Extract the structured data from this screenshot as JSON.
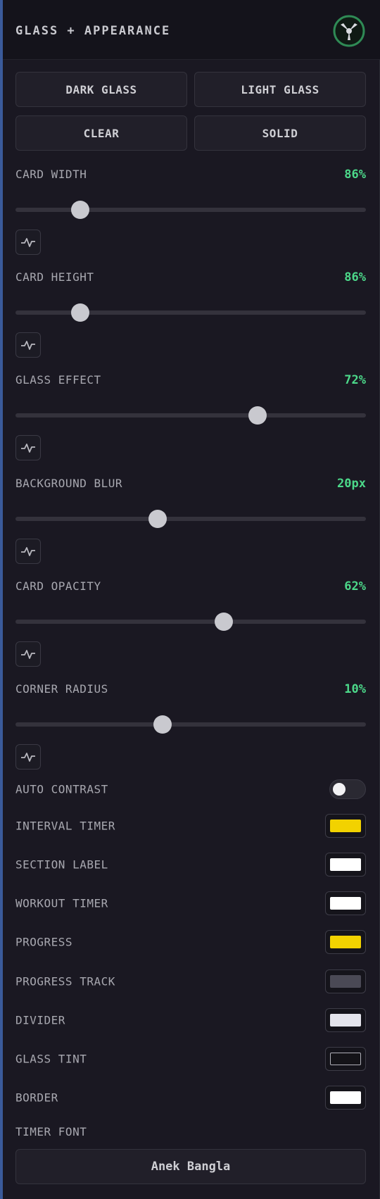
{
  "header": {
    "title": "GLASS + APPEARANCE",
    "logo_icon": "tri-blade-logo-icon"
  },
  "presets": [
    "DARK GLASS",
    "LIGHT GLASS",
    "CLEAR",
    "SOLID"
  ],
  "sliders": [
    {
      "label": "CARD WIDTH",
      "value": "86%",
      "position": 0.185
    },
    {
      "label": "CARD HEIGHT",
      "value": "86%",
      "position": 0.185
    },
    {
      "label": "GLASS EFFECT",
      "value": "72%",
      "position": 0.69
    },
    {
      "label": "BACKGROUND BLUR",
      "value": "20px",
      "position": 0.405
    },
    {
      "label": "CARD OPACITY",
      "value": "62%",
      "position": 0.595
    },
    {
      "label": "CORNER RADIUS",
      "value": "10%",
      "position": 0.42
    }
  ],
  "auto_contrast": {
    "label": "AUTO CONTRAST",
    "enabled": false
  },
  "colors": [
    {
      "label": "INTERVAL TIMER",
      "color": "#f2d200"
    },
    {
      "label": "SECTION LABEL",
      "color": "#ffffff"
    },
    {
      "label": "WORKOUT TIMER",
      "color": "#ffffff"
    },
    {
      "label": "PROGRESS",
      "color": "#f2d200"
    },
    {
      "label": "PROGRESS TRACK",
      "color": "#4a4955"
    },
    {
      "label": "DIVIDER",
      "color": "#e4e4ec"
    },
    {
      "label": "GLASS TINT",
      "color": "#141318"
    },
    {
      "label": "BORDER",
      "color": "#ffffff"
    }
  ],
  "timer_font": {
    "label": "TIMER FONT",
    "value": "Anek Bangla"
  },
  "accent_color": "#4cd98a"
}
